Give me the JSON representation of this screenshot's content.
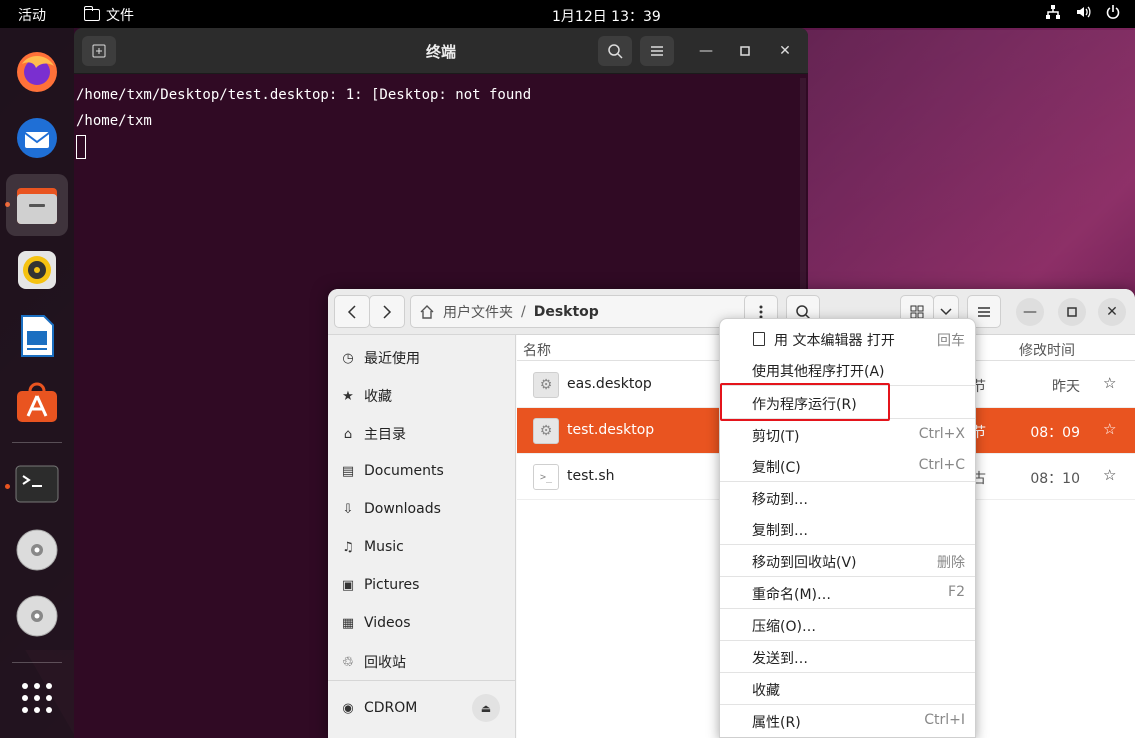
{
  "topbar": {
    "activities": "活动",
    "app_name": "文件",
    "clock": "1月12日  13：39",
    "icons": [
      "network-icon",
      "volume-icon",
      "power-icon"
    ]
  },
  "dock": {
    "apps": [
      "firefox",
      "thunderbird",
      "files",
      "rhythmbox",
      "libreoffice-writer",
      "app-center",
      "terminal",
      "cdrom",
      "cdrom",
      "show-apps"
    ]
  },
  "terminal": {
    "title": "终端",
    "lines": [
      "/home/txm/Desktop/test.desktop: 1: [Desktop: not found",
      "/home/txm"
    ],
    "bg_color": "#300a24"
  },
  "files": {
    "path": {
      "home": "用户文件夹",
      "separator": "/",
      "current": "Desktop"
    },
    "sidebar": {
      "items": [
        {
          "label": "最近使用",
          "icon": "clock-icon"
        },
        {
          "label": "收藏",
          "icon": "star-icon"
        },
        {
          "label": "主目录",
          "icon": "home-icon"
        },
        {
          "label": "Documents",
          "icon": "document-icon"
        },
        {
          "label": "Downloads",
          "icon": "download-icon"
        },
        {
          "label": "Music",
          "icon": "music-icon"
        },
        {
          "label": "Pictures",
          "icon": "picture-icon"
        },
        {
          "label": "Videos",
          "icon": "video-icon"
        },
        {
          "label": "回收站",
          "icon": "trash-icon"
        }
      ],
      "devices": [
        {
          "label": "CDROM",
          "icon": "disc-icon"
        }
      ]
    },
    "columns": {
      "name": "名称",
      "size": "节",
      "modified": "修改时间"
    },
    "rows": [
      {
        "name": "eas.desktop",
        "size": "节",
        "modified": "昨天",
        "selected": false
      },
      {
        "name": "test.desktop",
        "size": "节",
        "modified": "08：09",
        "selected": true
      },
      {
        "name": "test.sh",
        "size": "古",
        "modified": "08：10",
        "selected": false
      }
    ],
    "accent": "#e95420"
  },
  "context_menu": {
    "items": [
      {
        "label": "用 文本编辑器 打开",
        "shortcut": "回车"
      },
      {
        "label": "使用其他程序打开(A)",
        "shortcut": ""
      },
      {
        "label": "作为程序运行(R)",
        "shortcut": ""
      },
      {
        "label": "剪切(T)",
        "shortcut": "Ctrl+X"
      },
      {
        "label": "复制(C)",
        "shortcut": "Ctrl+C"
      },
      {
        "label": "移动到…",
        "shortcut": ""
      },
      {
        "label": "复制到…",
        "shortcut": ""
      },
      {
        "label": "移动到回收站(V)",
        "shortcut": "删除"
      },
      {
        "label": "重命名(M)…",
        "shortcut": "F2"
      },
      {
        "label": "压缩(O)…",
        "shortcut": ""
      },
      {
        "label": "发送到…",
        "shortcut": ""
      },
      {
        "label": "收藏",
        "shortcut": ""
      },
      {
        "label": "属性(R)",
        "shortcut": "Ctrl+I"
      }
    ],
    "highlight_color": "#e4141b"
  }
}
